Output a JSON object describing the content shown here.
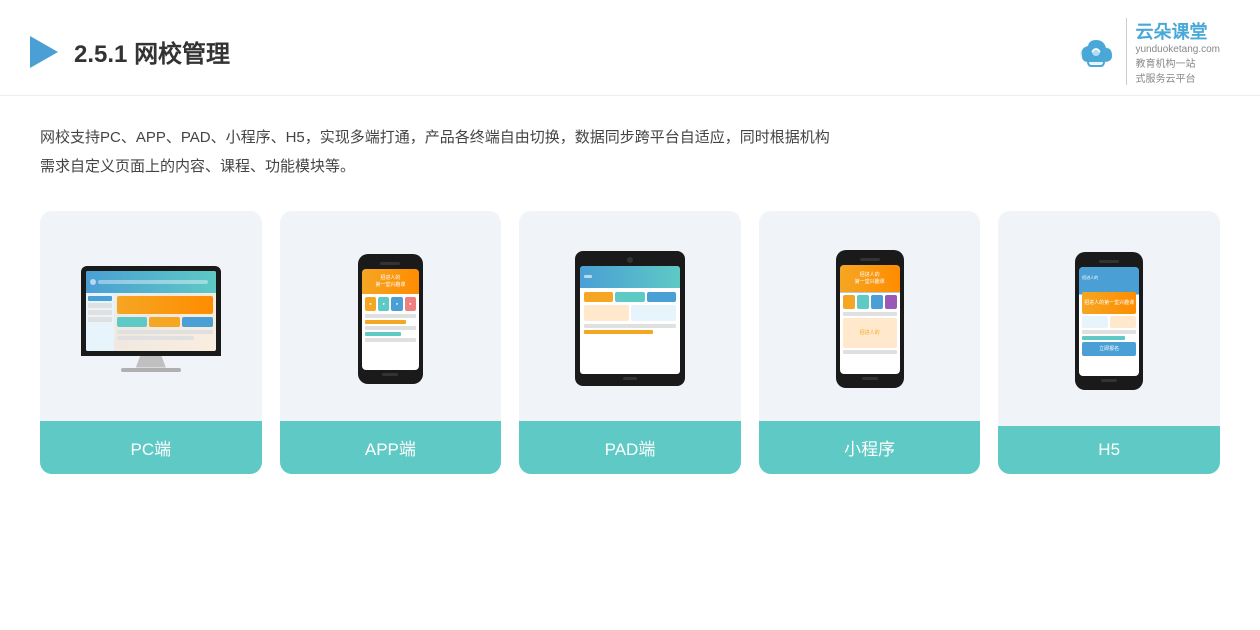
{
  "header": {
    "section_number": "2.5.1",
    "title": "网校管理",
    "logo": {
      "name": "云朵课堂",
      "url": "yunduoketang.com",
      "tagline1": "教育机构一站",
      "tagline2": "式服务云平台"
    }
  },
  "description": {
    "line1": "网校支持PC、APP、PAD、小程序、H5，实现多端打通，产品各终端自由切换，数据同步跨平台自适应，同时根据机构",
    "line2": "需求自定义页面上的内容、课程、功能模块等。"
  },
  "cards": [
    {
      "id": "pc",
      "label": "PC端"
    },
    {
      "id": "app",
      "label": "APP端"
    },
    {
      "id": "pad",
      "label": "PAD端"
    },
    {
      "id": "miniprogram",
      "label": "小程序"
    },
    {
      "id": "h5",
      "label": "H5"
    }
  ]
}
